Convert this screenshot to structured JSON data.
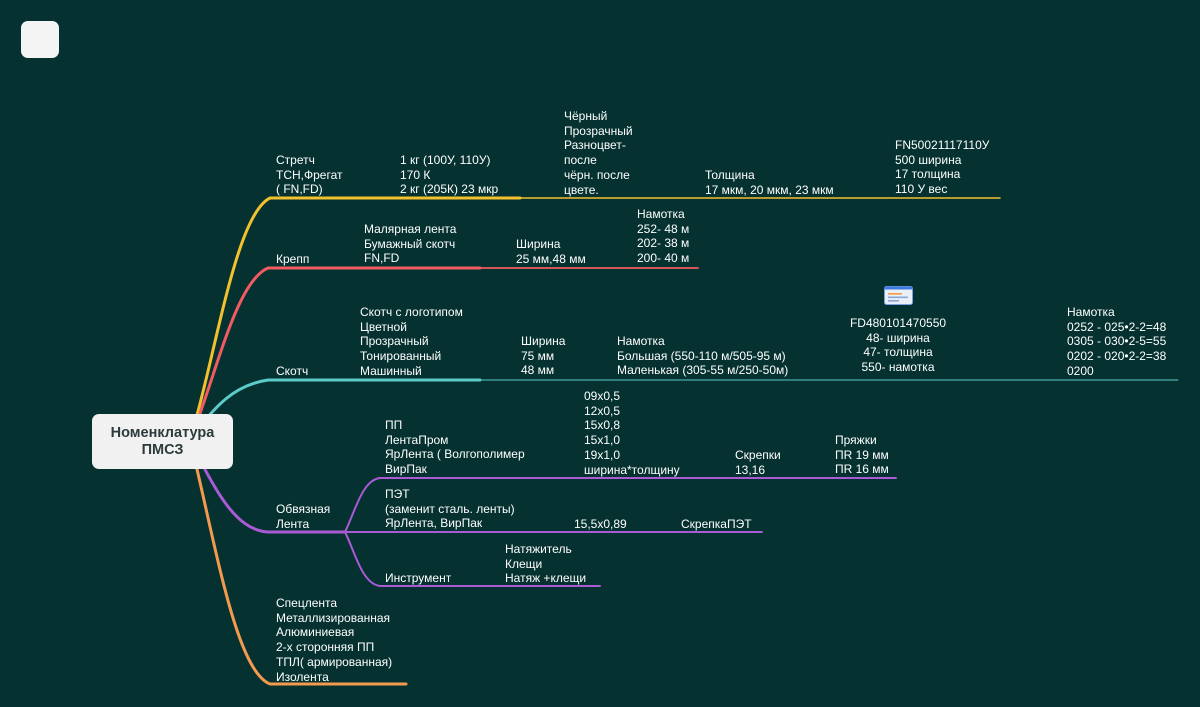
{
  "app": {
    "button_icon": "app-menu-icon"
  },
  "root": {
    "text": "Номенклатура\nПМСЗ"
  },
  "colors": {
    "background": "#053130",
    "stretch": "#f2c12e",
    "krepp": "#f15b61",
    "skotch": "#5ccbc9",
    "obvyaz": "#a95bd6",
    "speclenta": "#f49a4f"
  },
  "stretch": {
    "label": "Стретч\nТСН,Фрегат\n( FN,FD)",
    "weights": "1 кг (100У, 110У)\n170 К\n2 кг (205К) 23 мкр",
    "colors": "Чёрный\nПрозрачный\nРазноцвет-\nпосле\nчёрн. после\nцвете.",
    "thickness": "Толщина\n17 мкм, 20 мкм, 23 мкм",
    "article": "FN50021117110У\n500 ширина\n17 толщина\n110 У вес"
  },
  "krepp": {
    "label": "Крепп",
    "types": "Малярная лента\nБумажный скотч\nFN,FD",
    "width": "Ширина\n25 мм,48 мм",
    "winding": "Намотка\n252- 48 м\n202- 38 м\n200- 40 м"
  },
  "skotch": {
    "label": "Скотч",
    "types": "Скотч с логотипом\nЦветной\nПрозрачный\nТонированный\nМашинный",
    "width": "Ширина\n75 мм\n48 мм",
    "winding": "Намотка\nБольшая (550-110 м/505-95 м)\nМаленькая (305-55 м/250-50м)",
    "article": "FD480101470550\n48- ширина\n47- толщина\n550- намотка",
    "note_icon": "note-icon",
    "codes": "Намотка\n0252 - 025•2-2=48\n0305 - 030•2-5=55\n0202 - 020•2-2=38\n0200"
  },
  "obvyaz": {
    "label": "Обвязная\nЛента",
    "pp": {
      "label": "ПП\nЛентаПром\nЯрЛента ( Волгополимер\nВирПак",
      "sizes": "09х0,5\n12х0,5\n15х0,8\n15х1,0\n19х1,0\nширина*толщину",
      "clips": "Скрепки\n13,16",
      "buckles": "Пряжки\nПR 19 мм\nПR 16 мм"
    },
    "pet": {
      "label": "ПЭТ\n(заменит сталь. ленты)\nЯрЛента, ВирПак",
      "size": "15,5х0,89",
      "clip": "СкрепкаПЭТ"
    },
    "tool": {
      "label": "Инструмент",
      "items": "Натяжитель\nКлещи\nНатяж +клещи"
    }
  },
  "speclenta": {
    "label": "Спецлента\nМеталлизированная\nАлюминиевая\n2-х сторонняя ПП\nТПЛ( армированная)\nИзолента"
  }
}
